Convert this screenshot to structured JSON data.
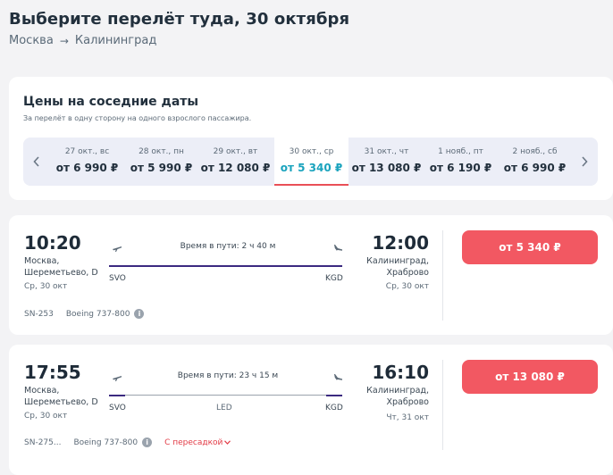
{
  "header": {
    "title": "Выберите перелёт туда, 30 октября",
    "route_from": "Москва",
    "route_arrow": "→",
    "route_to": "Калининград"
  },
  "nearby_dates": {
    "title": "Цены на соседние даты",
    "subtitle": "За перелёт в одну сторону на одного взрослого пассажира.",
    "prev_icon": "chevron-left-icon",
    "next_icon": "chevron-right-icon",
    "selected_index": 3,
    "dates": [
      {
        "label": "27 окт., вс",
        "price": "от 6 990 ₽"
      },
      {
        "label": "28 окт., пн",
        "price": "от 5 990 ₽"
      },
      {
        "label": "29 окт., вт",
        "price": "от 12 080 ₽"
      },
      {
        "label": "30 окт., ср",
        "price": "от 5 340 ₽"
      },
      {
        "label": "31 окт., чт",
        "price": "от 13 080 ₽"
      },
      {
        "label": "1 нояб., пт",
        "price": "от 6 190 ₽"
      },
      {
        "label": "2 нояб., сб",
        "price": "от 6 990 ₽"
      }
    ]
  },
  "flights": [
    {
      "dep_time": "10:20",
      "dep_city": "Москва,",
      "dep_airport": "Шереметьево, D",
      "dep_date": "Ср, 30 окт",
      "duration": "Время в пути: 2 ч 40 м",
      "from_code": "SVO",
      "to_code": "KGD",
      "arr_time": "12:00",
      "arr_city": "Калининград,",
      "arr_airport": "Храброво",
      "arr_date": "Ср, 30 окт",
      "flight_no": "SN-253",
      "aircraft": "Boeing 737-800",
      "price": "от 5 340 ₽"
    },
    {
      "dep_time": "17:55",
      "dep_city": "Москва,",
      "dep_airport": "Шереметьево, D",
      "dep_date": "Ср, 30 окт",
      "duration": "Время в пути: 23 ч 15 м",
      "from_code": "SVO",
      "via_code": "LED",
      "to_code": "KGD",
      "arr_time": "16:10",
      "arr_city": "Калининград,",
      "arr_airport": "Храброво",
      "arr_date": "Чт, 31 окт",
      "flight_no": "SN-275...",
      "aircraft": "Boeing 737-800",
      "transfer_label": "С пересадкой",
      "price": "от 13 080 ₽"
    }
  ],
  "colors": {
    "accent_price": "#f25862",
    "selected_date_price": "#1aa3bd",
    "track": "#3b2a80",
    "transfer": "#e23b46"
  }
}
